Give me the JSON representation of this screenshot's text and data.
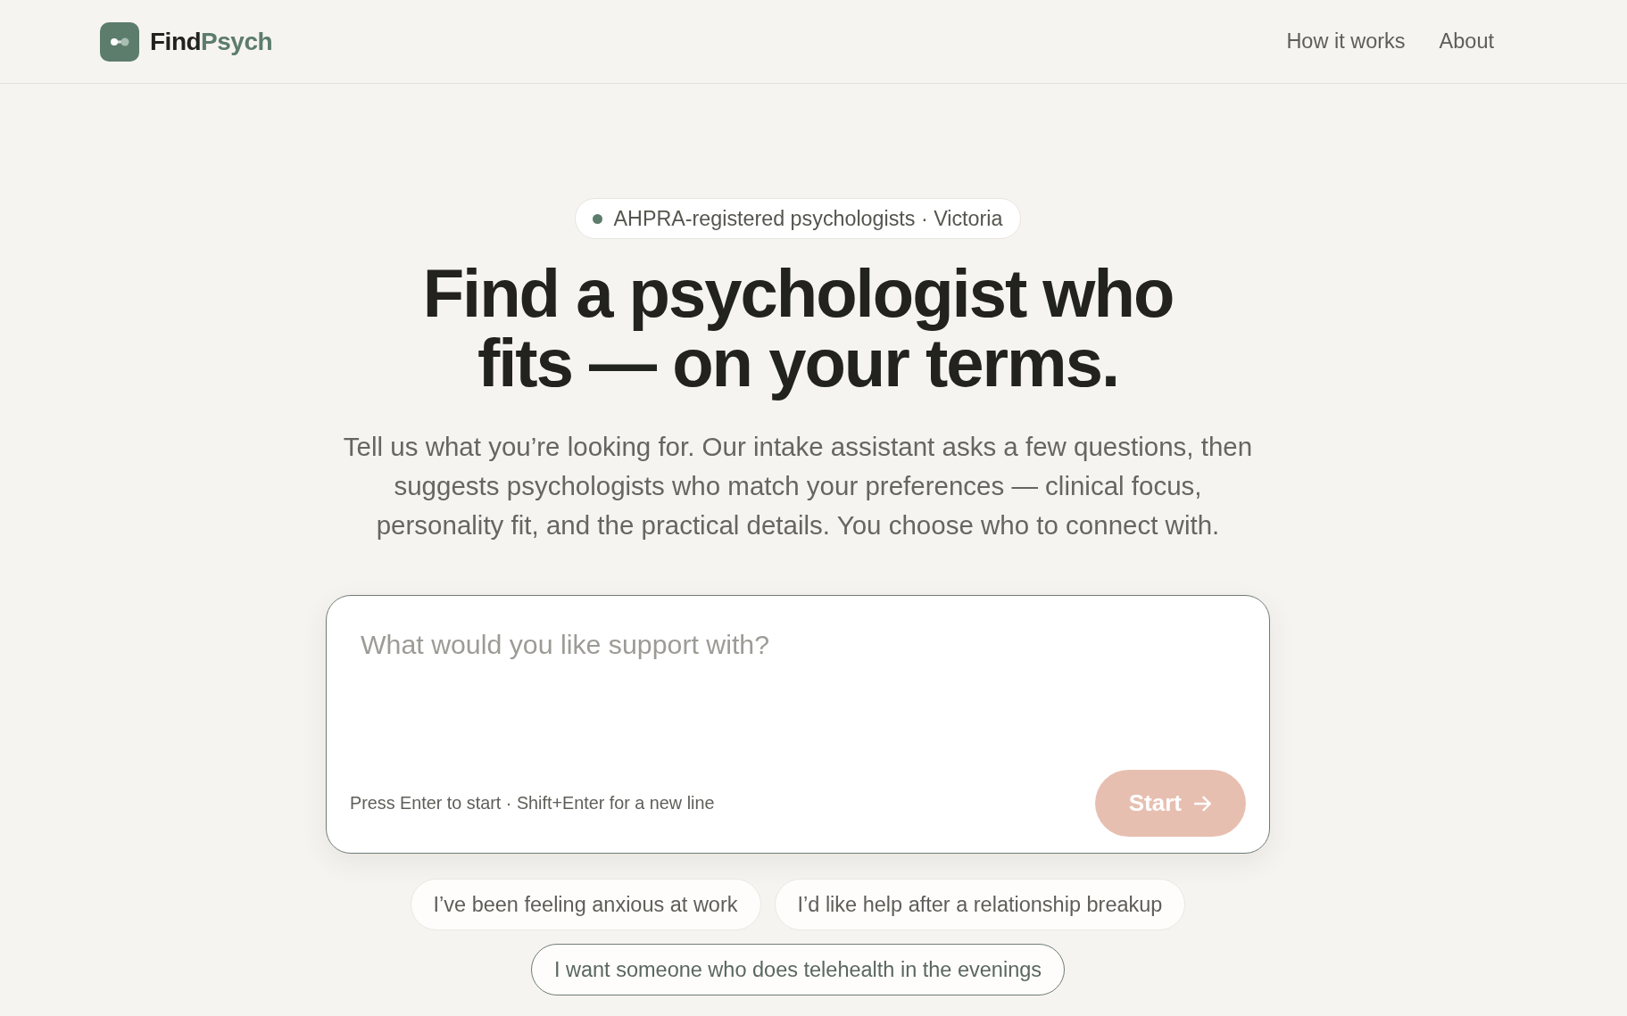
{
  "header": {
    "logo": {
      "name_first": "Find",
      "name_second": "Psych"
    },
    "nav": [
      {
        "label": "How it works"
      },
      {
        "label": "About"
      }
    ]
  },
  "hero": {
    "badge": "AHPRA-registered psychologists · Victoria",
    "title": "Find a psychologist who fits — on your terms.",
    "description": "Tell us what you’re looking for. Our intake assistant asks a few questions, then suggests psychologists who match your preferences — clinical focus, personality fit, and the practical details. You choose who to connect with."
  },
  "composer": {
    "placeholder": "What would you like support with?",
    "focused": true,
    "hint": "Press Enter to start · Shift+Enter for a new line",
    "submit": {
      "label": "Start",
      "disabled": true
    }
  },
  "suggestions": [
    {
      "label": "I’ve been feeling anxious at work",
      "focused": false
    },
    {
      "label": "I’d like help after a relationship breakup",
      "focused": false
    },
    {
      "label": "I want someone who does telehealth in the evenings",
      "focused": true
    }
  ]
}
